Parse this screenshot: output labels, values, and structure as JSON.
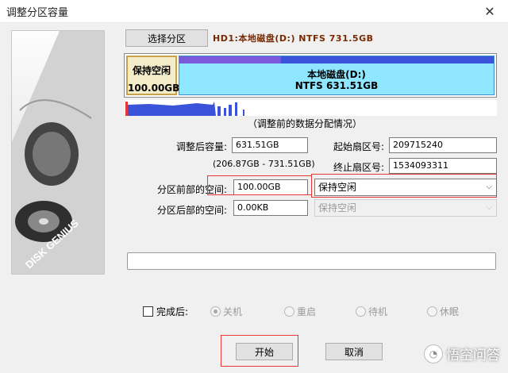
{
  "window": {
    "title": "调整分区容量",
    "close_glyph": "✕"
  },
  "sidebar_image": {
    "brand_text": "DISK GENIUS"
  },
  "toolbar": {
    "select_partition_label": "选择分区"
  },
  "disk_info": "HD1:本地磁盘(D:) NTFS 731.5GB",
  "partition_bar": {
    "free": {
      "label": "保持空闲",
      "size": "100.00GB"
    },
    "ntfs": {
      "name": "本地磁盘(D:)",
      "desc": "NTFS 631.51GB"
    }
  },
  "data_map_caption": "（调整前的数据分配情况）",
  "form": {
    "adjusted_size_label": "调整后容量:",
    "adjusted_size_value": "631.51GB",
    "range_hint": "(206.87GB - 731.51GB)",
    "start_sector_label": "起始扇区号:",
    "start_sector_value": "209715240",
    "end_sector_label": "终止扇区号:",
    "end_sector_value": "1534093311",
    "front_space_label": "分区前部的空间:",
    "front_space_value": "100.00GB",
    "front_space_action": "保持空闲",
    "back_space_label": "分区后部的空间:",
    "back_space_value": "0.00KB",
    "back_space_action": "保持空闲"
  },
  "after_complete": {
    "label": "完成后:",
    "options": [
      "关机",
      "重启",
      "待机",
      "休眠"
    ],
    "selected": "关机"
  },
  "buttons": {
    "start": "开始",
    "cancel": "取消"
  },
  "watermark": {
    "logo_glyph": "◔",
    "text": "悟空问答"
  }
}
